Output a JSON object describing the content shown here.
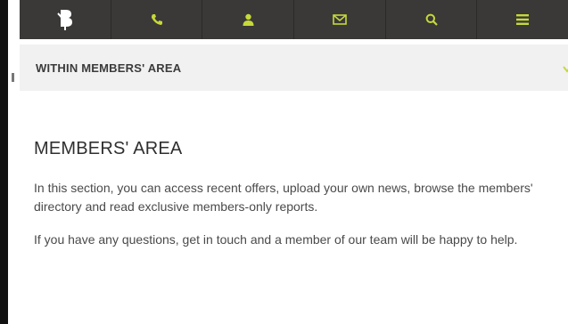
{
  "topbar": {
    "items": [
      {
        "icon": "logo-icon",
        "color": "#ffffff"
      },
      {
        "icon": "phone-icon",
        "color": "#c6d93a"
      },
      {
        "icon": "user-icon",
        "color": "#c6d93a"
      },
      {
        "icon": "mail-icon",
        "color": "#c6d93a"
      },
      {
        "icon": "search-icon",
        "color": "#c6d93a"
      },
      {
        "icon": "menu-icon",
        "color": "#c6d93a"
      }
    ]
  },
  "subnav": {
    "label": "WITHIN MEMBERS' AREA",
    "chevron_icon": "chevron-down-icon"
  },
  "main": {
    "title": "MEMBERS' AREA",
    "paragraphs": [
      "In this section, you can access recent offers, upload your own news, browse the members' directory and read exclusive members-only reports.",
      "If you have any questions, get in touch and a member of our team will be happy to help."
    ]
  },
  "colors": {
    "accent": "#c6d93a",
    "topbar_bg": "#3a3937",
    "subnav_bg": "#f1f1f1"
  }
}
